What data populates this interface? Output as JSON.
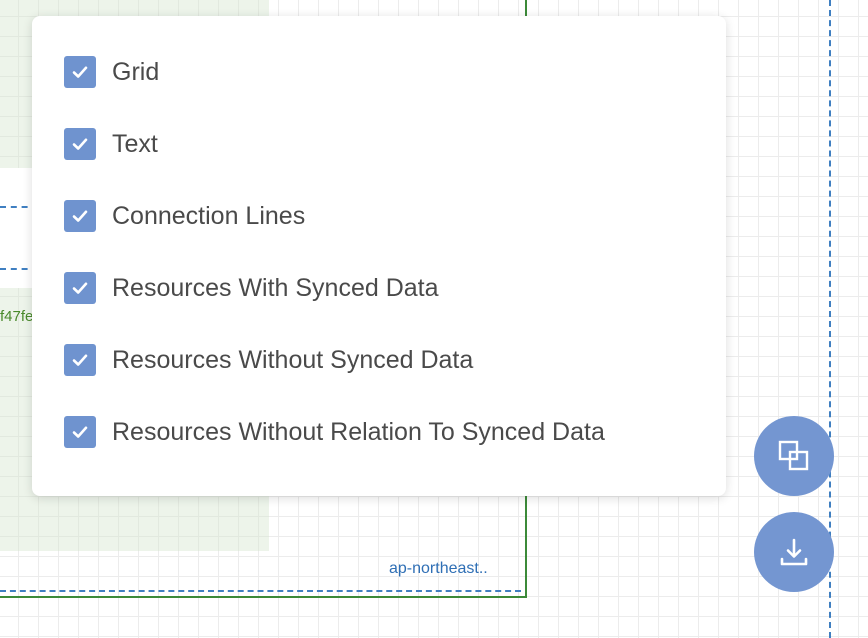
{
  "colors": {
    "checkbox_fill": "#6f93cf",
    "fab_fill": "#7496d1",
    "group_border": "#3c8a39",
    "dashed_border": "#3f7fc1"
  },
  "canvas": {
    "region_label": "ap-northeast..",
    "resource_id_fragment": "f47fe"
  },
  "menu": {
    "items": [
      {
        "label": "Grid",
        "checked": true
      },
      {
        "label": "Text",
        "checked": true
      },
      {
        "label": "Connection Lines",
        "checked": true
      },
      {
        "label": "Resources With Synced Data",
        "checked": true
      },
      {
        "label": "Resources Without Synced Data",
        "checked": true
      },
      {
        "label": "Resources Without Relation To Synced Data",
        "checked": true
      }
    ]
  },
  "fabs": {
    "layers_icon": "layers-icon",
    "download_icon": "download-icon"
  }
}
